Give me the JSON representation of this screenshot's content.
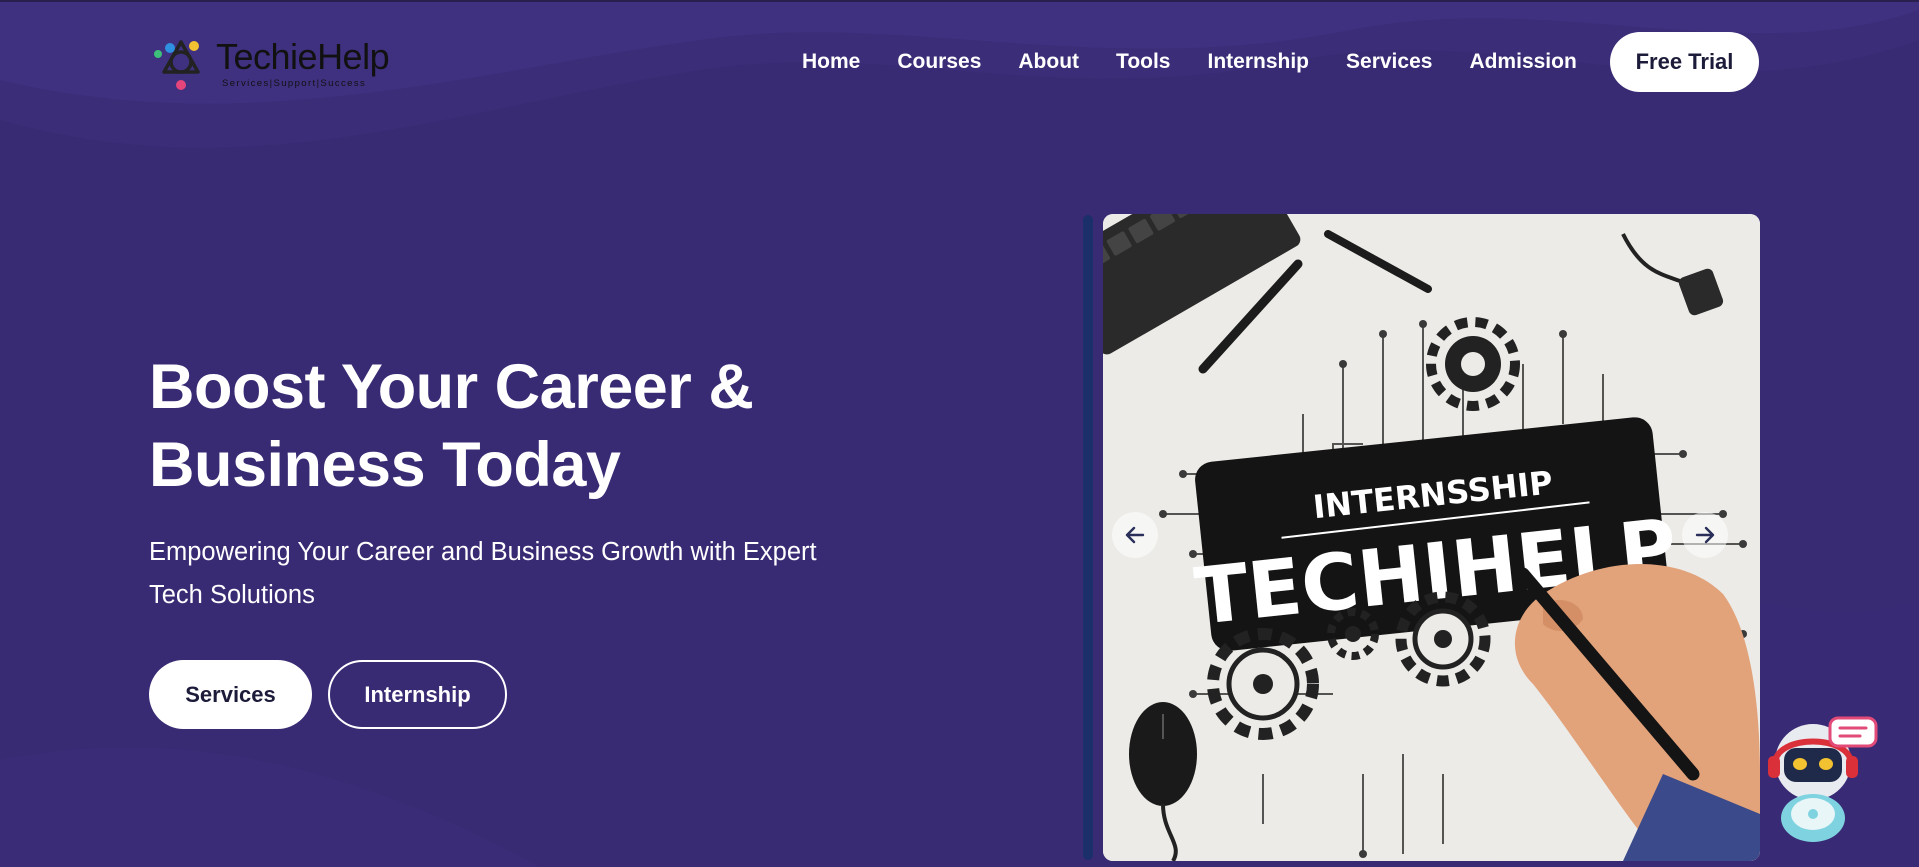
{
  "brand": {
    "name": "TechieHelp",
    "tagline": "Services|Support|Success"
  },
  "nav": {
    "items": [
      {
        "label": "Home"
      },
      {
        "label": "Courses"
      },
      {
        "label": "About"
      },
      {
        "label": "Tools"
      },
      {
        "label": "Internship"
      },
      {
        "label": "Services"
      },
      {
        "label": "Admission"
      }
    ],
    "cta_label": "Free Trial"
  },
  "hero": {
    "title_line1": "Boost Your Career &",
    "title_line2": "Business Today",
    "subtitle_line1": "Empowering Your Career and Business Growth with Expert",
    "subtitle_line2": "Tech Solutions",
    "primary_button": "Services",
    "secondary_button": "Internship"
  },
  "carousel": {
    "slide_heading": "INTERNSSHIP",
    "slide_title": "TECHIHELP"
  },
  "icons": {
    "prev": "arrow-left-icon",
    "next": "arrow-right-icon",
    "chat": "chatbot-icon"
  },
  "colors": {
    "background": "#382a73",
    "button_text": "#1c1b3a",
    "accent_bar": "#1b2f6a"
  }
}
